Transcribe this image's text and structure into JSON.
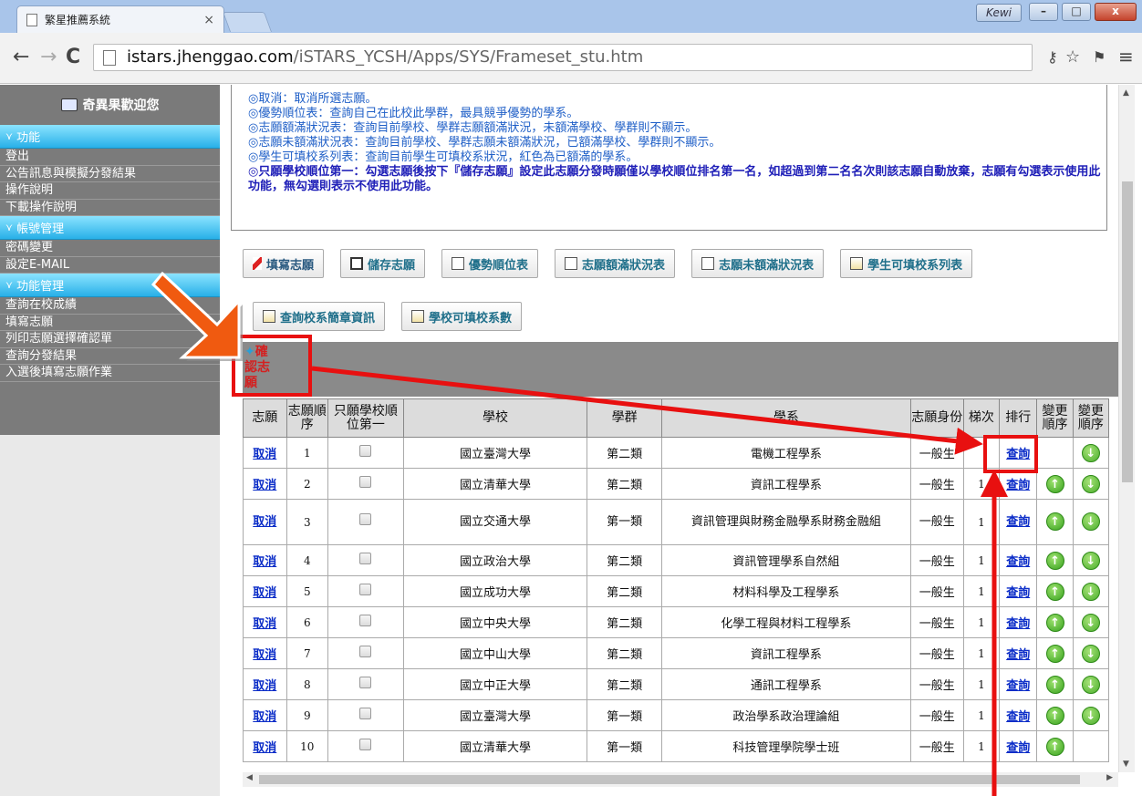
{
  "browser": {
    "tab_title": "繁星推薦系統",
    "tab_close": "×",
    "profile_label": "Kewi",
    "url_domain": "istars.jhenggao.com",
    "url_path": "/iSTARS_YCSH/Apps/SYS/Frameset_stu.htm",
    "nav": {
      "back": "←",
      "forward": "→",
      "reload": "C"
    }
  },
  "sidebar": {
    "welcome": "奇異果歡迎您",
    "sections": [
      {
        "title": "功能",
        "items": [
          "登出",
          "公告訊息與模擬分發結果",
          "操作說明",
          "下載操作說明"
        ]
      },
      {
        "title": "帳號管理",
        "items": [
          "密碼變更",
          "設定E-MAIL"
        ]
      },
      {
        "title": "功能管理",
        "items": [
          "查詢在校成績",
          "填寫志願",
          "列印志願選擇確認單",
          "查詢分發結果",
          "入選後填寫志願作業"
        ]
      }
    ]
  },
  "info": {
    "lines": [
      "◎取消：取消所選志願。",
      "◎優勢順位表：查詢自己在此校此學群，最具競爭優勢的學系。",
      "◎志願額滿狀況表：查詢目前學校、學群志願額滿狀況，未額滿學校、學群則不顯示。",
      "◎志願未額滿狀況表：查詢目前學校、學群志願未額滿狀況，已額滿學校、學群則不顯示。",
      "◎學生可填校系列表：查詢目前學生可填校系狀況，紅色為已額滿的學系。"
    ],
    "bold_line": "◎只願學校順位第一：勾選志願後按下『儲存志願』設定此志願分發時願僅以學校順位排名第一名，如超過到第二名名次則該志願自動放棄，志願有勾選表示使用此功能，無勾選則表示不使用此功能。"
  },
  "toolbar": {
    "row1": [
      "填寫志願",
      "儲存志願",
      "優勢順位表",
      "志願額滿狀況表",
      "志願未額滿狀況表",
      "學生可填校系列表"
    ],
    "row2": [
      "查詢校系簡章資訊",
      "學校可填校系數"
    ]
  },
  "confirm_label": "確認志願",
  "table": {
    "headers": [
      "志願",
      "志願順序",
      "只願學校順位第一",
      "學校",
      "學群",
      "學系",
      "志願身份",
      "梯次",
      "排行",
      "變更順序",
      "變更順序"
    ],
    "rows": [
      {
        "action": "取消",
        "order": "1",
        "school": "國立臺灣大學",
        "group": "第二類",
        "dept": "電機工程學系",
        "identity": "一般生",
        "round": "",
        "rank": "查詢",
        "up": false,
        "down": true
      },
      {
        "action": "取消",
        "order": "2",
        "school": "國立清華大學",
        "group": "第二類",
        "dept": "資訊工程學系",
        "identity": "一般生",
        "round": "1",
        "rank": "查詢",
        "up": true,
        "down": true
      },
      {
        "action": "取消",
        "order": "3",
        "school": "國立交通大學",
        "group": "第一類",
        "dept": "資訊管理與財務金融學系財務金融組",
        "identity": "一般生",
        "round": "1",
        "rank": "查詢",
        "up": true,
        "down": true
      },
      {
        "action": "取消",
        "order": "4",
        "school": "國立政治大學",
        "group": "第二類",
        "dept": "資訊管理學系自然組",
        "identity": "一般生",
        "round": "1",
        "rank": "查詢",
        "up": true,
        "down": true
      },
      {
        "action": "取消",
        "order": "5",
        "school": "國立成功大學",
        "group": "第二類",
        "dept": "材料科學及工程學系",
        "identity": "一般生",
        "round": "1",
        "rank": "查詢",
        "up": true,
        "down": true
      },
      {
        "action": "取消",
        "order": "6",
        "school": "國立中央大學",
        "group": "第二類",
        "dept": "化學工程與材料工程學系",
        "identity": "一般生",
        "round": "1",
        "rank": "查詢",
        "up": true,
        "down": true
      },
      {
        "action": "取消",
        "order": "7",
        "school": "國立中山大學",
        "group": "第二類",
        "dept": "資訊工程學系",
        "identity": "一般生",
        "round": "1",
        "rank": "查詢",
        "up": true,
        "down": true
      },
      {
        "action": "取消",
        "order": "8",
        "school": "國立中正大學",
        "group": "第二類",
        "dept": "通訊工程學系",
        "identity": "一般生",
        "round": "1",
        "rank": "查詢",
        "up": true,
        "down": true
      },
      {
        "action": "取消",
        "order": "9",
        "school": "國立臺灣大學",
        "group": "第一類",
        "dept": "政治學系政治理論組",
        "identity": "一般生",
        "round": "1",
        "rank": "查詢",
        "up": true,
        "down": true
      },
      {
        "action": "取消",
        "order": "10",
        "school": "國立清華大學",
        "group": "第一類",
        "dept": "科技管理學院學士班",
        "identity": "一般生",
        "round": "1",
        "rank": "查詢",
        "up": true,
        "down": false
      }
    ]
  },
  "colors": {
    "accent_red": "#e81010",
    "sidebar_head": "#28b0e8",
    "link": "#0b2dc8",
    "info_text": "#1f5fc7"
  }
}
